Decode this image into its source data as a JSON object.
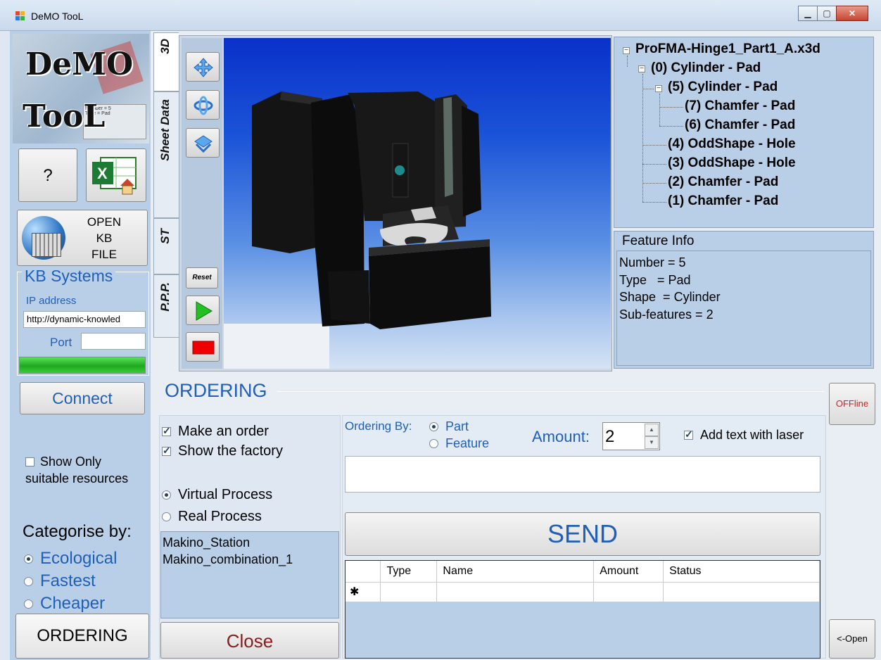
{
  "window": {
    "title": "DeMO TooL",
    "minimize": "▁",
    "maximize": "▢",
    "close": "✕"
  },
  "logo": {
    "line1": "DeMO",
    "line2": "TooL",
    "snippet": "Number = 5\nType = Pad"
  },
  "left": {
    "help_label": "?",
    "open_kb_label": "OPEN\nKB\nFILE",
    "kb": {
      "title": "KB Systems",
      "ip_label": "IP address",
      "ip_value": "http://dynamic-knowled",
      "port_label": "Port",
      "port_value": "",
      "progress": 1.0
    },
    "connect_label": "Connect",
    "show_only_line1": "Show Only",
    "show_only_line2": "suitable resources",
    "show_only_checked": false,
    "categorise_title": "Categorise by:",
    "categories": [
      {
        "label": "Ecological",
        "selected": true
      },
      {
        "label": "Fastest",
        "selected": false
      },
      {
        "label": "Cheaper",
        "selected": false
      }
    ],
    "ordering_label": "ORDERING"
  },
  "tabs": [
    "3D",
    "Sheet Data",
    "ST",
    "P.P.P."
  ],
  "toolbar": {
    "reset_label": "Reset",
    "icons": [
      "move-icon",
      "rotate-icon",
      "tilt-icon",
      "play-icon",
      "stop-icon"
    ]
  },
  "tree": {
    "root": "ProFMA-Hinge1_Part1_A.x3d",
    "nodes": [
      "(0) Cylinder - Pad",
      "(5) Cylinder - Pad",
      "(7) Chamfer - Pad",
      "(6) Chamfer - Pad",
      "(4) OddShape - Hole",
      "(3) OddShape - Hole",
      "(2) Chamfer - Pad",
      "(1) Chamfer - Pad"
    ]
  },
  "feature_info": {
    "title": "Feature Info",
    "lines": [
      "Number = 5",
      "Type   = Pad",
      "Shape  = Cylinder",
      "Sub-features = 2"
    ]
  },
  "ordering": {
    "title": "ORDERING",
    "make_order": "Make an order",
    "show_factory": "Show the factory",
    "virtual": "Virtual Process",
    "real": "Real Process",
    "resources": [
      "Makino_Station",
      "Makino_combination_1"
    ],
    "close_label": "Close",
    "ordering_by_label": "Ordering By:",
    "by_part": "Part",
    "by_feature": "Feature",
    "amount_label": "Amount:",
    "amount_value": "2",
    "laser_label": "Add text with laser",
    "send_label": "SEND",
    "grid_headers": [
      "",
      "Type",
      "Name",
      "Amount",
      "Status"
    ],
    "new_row_marker": "✱"
  },
  "right": {
    "offline_label": "OFFline",
    "open_label": "<-Open"
  },
  "colors": {
    "accent": "#1f5fb8",
    "panel": "#b9cfe8",
    "offline": "#d02020",
    "close_text": "#8c1b1b"
  }
}
